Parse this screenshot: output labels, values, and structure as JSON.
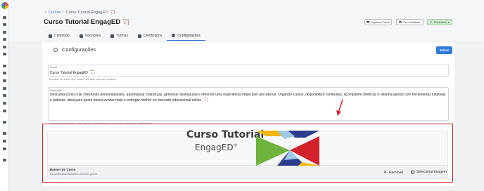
{
  "breadcrumb": {
    "chevron": "‹",
    "parent": "Cursos",
    "separator": "/",
    "current": "Curso Tutorial EngagED",
    "emoji": "🏹"
  },
  "page": {
    "title": "Curso Tutorial EngagED",
    "emoji": "🏹"
  },
  "header_actions": {
    "explore": "Explorar Curso",
    "preview": "Pré-visualizar",
    "published": "Publicado",
    "published_caret": "▾"
  },
  "tabs": [
    {
      "label": "Conteúdo",
      "icon": "content-icon"
    },
    {
      "label": "Inscrições",
      "icon": "users-icon"
    },
    {
      "label": "Turmas",
      "icon": "classes-icon"
    },
    {
      "label": "Certificados",
      "icon": "certificate-icon"
    },
    {
      "label": "Configurações",
      "icon": "gear-icon",
      "active": true
    }
  ],
  "settings": {
    "title": "Configurações",
    "save": "Salvar"
  },
  "form": {
    "name_label": "Nome",
    "name_value": "Curso Tutorial EngagED",
    "name_emoji": "🏹",
    "name_helper": "Escolha um nome que chame atenção para seu produto.",
    "description_label": "Descrição",
    "description_value": "Descubra como criar checkouts personalizáveis, automatizar cobranças, gerenciar assinaturas e oferecer uma experiência impecável aos alunos. Organize cursos, disponibilize conteúdos, acompanhe métricas e retenha alunos com ferramentas intuitivas e práticas, ideal para quem busca vender mais e entregar melhor no mercado educacional online",
    "description_emoji": "🏹",
    "description_helper": "Descreva brevemente o seu produto, destacando os principais benefícios e diferenciais."
  },
  "banner": {
    "logo_line1": "Curso Tutorial",
    "logo_line2": "EngagED",
    "logo_mark": "®",
    "title": "Banner do Curso",
    "recommendation": "Recomendado tamanho 300x200 pixels",
    "remove": "Remover",
    "select": "Selecionar imagem"
  },
  "colors": {
    "accent": "#2f7cd6",
    "highlight": "#d2232a",
    "published_bg": "#cfe8cf"
  }
}
